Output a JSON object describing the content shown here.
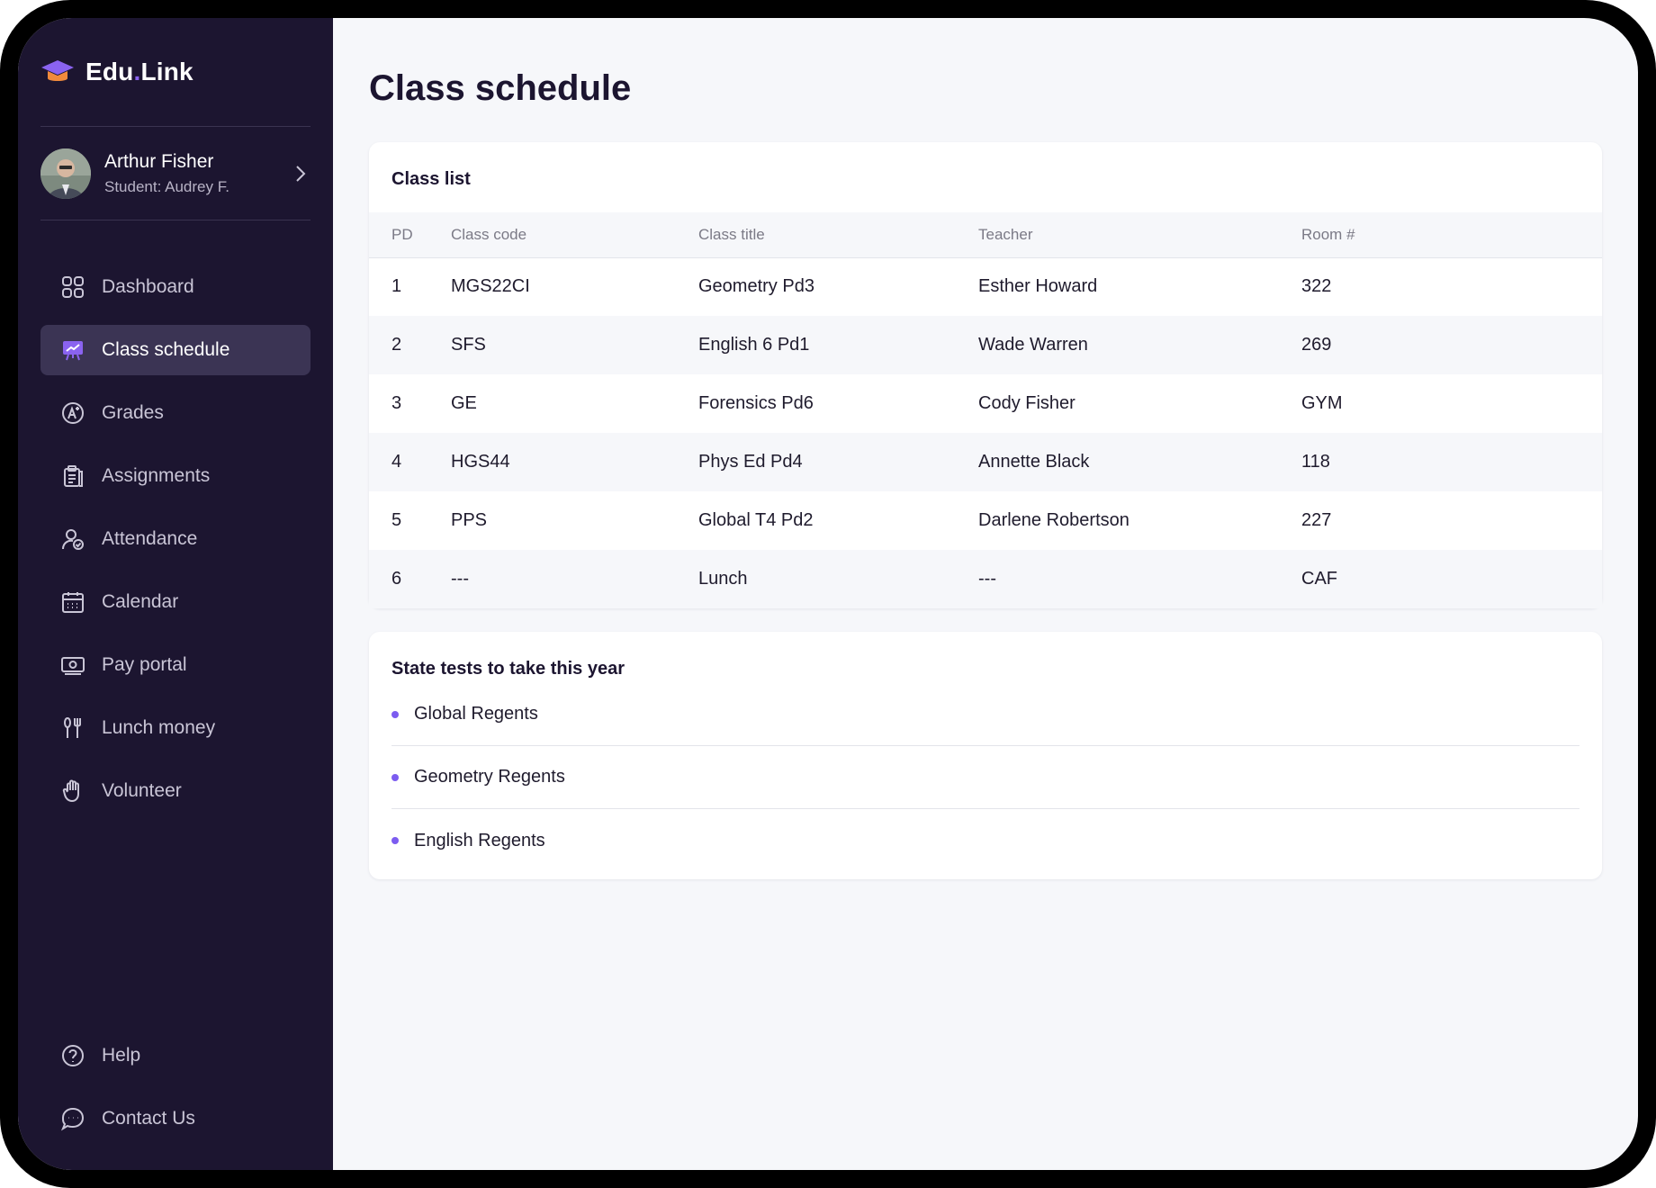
{
  "app": {
    "logo_prefix": "Edu",
    "logo_dot": ".",
    "logo_suffix": "Link",
    "accent_color": "#7c5cf0",
    "sidebar_bg": "#1c1530"
  },
  "user": {
    "name": "Arthur Fisher",
    "subtitle": "Student: Audrey F."
  },
  "nav": {
    "items": [
      {
        "label": "Dashboard",
        "icon": "grid-icon"
      },
      {
        "label": "Class schedule",
        "icon": "presentation-board-icon",
        "active": true
      },
      {
        "label": "Grades",
        "icon": "grade-badge-icon"
      },
      {
        "label": "Assignments",
        "icon": "clipboard-icon"
      },
      {
        "label": "Attendance",
        "icon": "user-check-icon"
      },
      {
        "label": "Calendar",
        "icon": "calendar-icon"
      },
      {
        "label": "Pay portal",
        "icon": "money-icon"
      },
      {
        "label": "Lunch money",
        "icon": "utensils-icon"
      },
      {
        "label": "Volunteer",
        "icon": "hand-icon"
      }
    ],
    "bottom": [
      {
        "label": "Help",
        "icon": "help-circle-icon"
      },
      {
        "label": "Contact Us",
        "icon": "chat-bubble-icon"
      }
    ]
  },
  "page": {
    "title": "Class schedule"
  },
  "class_list": {
    "title": "Class list",
    "columns": [
      "PD",
      "Class code",
      "Class title",
      "Teacher",
      "Room #"
    ],
    "rows": [
      [
        "1",
        "MGS22CI",
        "Geometry Pd3",
        "Esther Howard",
        "322"
      ],
      [
        "2",
        "SFS",
        "English 6 Pd1",
        "Wade Warren",
        "269"
      ],
      [
        "3",
        "GE",
        "Forensics Pd6",
        "Cody Fisher",
        "GYM"
      ],
      [
        "4",
        "HGS44",
        "Phys Ed Pd4",
        "Annette Black",
        "118"
      ],
      [
        "5",
        "PPS",
        "Global T4 Pd2",
        "Darlene Robertson",
        "227"
      ],
      [
        "6",
        "---",
        "Lunch",
        "---",
        "CAF"
      ]
    ]
  },
  "state_tests": {
    "title": "State tests to take this year",
    "items": [
      "Global Regents",
      "Geometry Regents",
      "English Regents"
    ]
  }
}
